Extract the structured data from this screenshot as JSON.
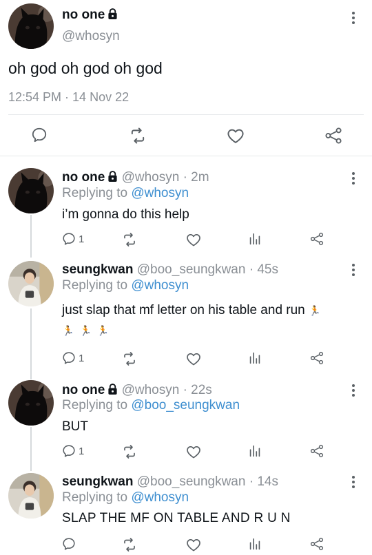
{
  "colors": {
    "link": "#3f8fd0",
    "muted": "#8a8f95",
    "icon": "#5b6166",
    "divider": "#e6e8ea"
  },
  "main_tweet": {
    "display_name": "no one",
    "handle": "@whosyn",
    "text": "oh god oh god oh god",
    "timestamp": "12:54 PM · 14 Nov 22",
    "actions": [
      "reply-icon",
      "retweet-icon",
      "like-icon",
      "share-icon"
    ]
  },
  "replies": [
    {
      "display_name": "no one",
      "handle": "@whosyn",
      "time": "· 2m",
      "replying_label": "Replying to",
      "replying_to": "@whosyn",
      "text": "i’m gonna do this help",
      "reply_count": "1",
      "protected": true
    },
    {
      "display_name": "seungkwan",
      "handle": "@boo_seungkwan",
      "time": "· 45s",
      "replying_label": "Replying to",
      "replying_to": "@whosyn",
      "text": "just slap that mf letter on his table and run",
      "emoji": "🏃",
      "reply_count": "1",
      "protected": false
    },
    {
      "display_name": "no one",
      "handle": "@whosyn",
      "time": "· 22s",
      "replying_label": "Replying to",
      "replying_to": "@boo_seungkwan",
      "text": "BUT",
      "reply_count": "1",
      "protected": true
    },
    {
      "display_name": "seungkwan",
      "handle": "@boo_seungkwan",
      "time": "· 14s",
      "replying_label": "Replying to",
      "replying_to": "@whosyn",
      "text": "SLAP THE MF ON TABLE AND R U N",
      "reply_count": "",
      "protected": false
    }
  ]
}
